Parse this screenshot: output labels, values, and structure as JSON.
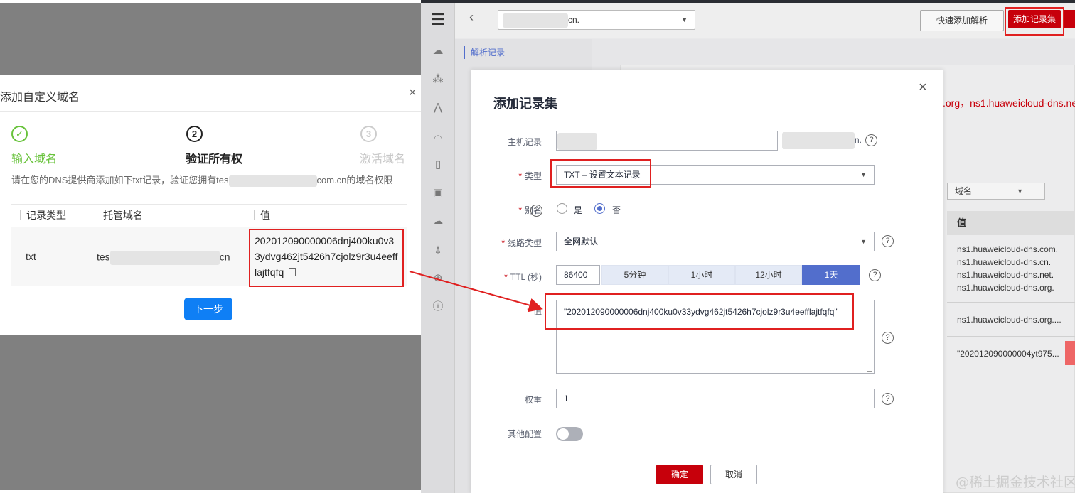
{
  "left_dialog": {
    "title": "添加自定义域名",
    "close_glyph": "×",
    "steps": [
      {
        "num": "✓",
        "label": "输入域名",
        "state": "done"
      },
      {
        "num": "2",
        "label": "验证所有权",
        "state": "active"
      },
      {
        "num": "3",
        "label": "激活域名",
        "state": "pending"
      }
    ],
    "desc_prefix": "请在您的DNS提供商添加如下txt记录，验证您拥有tes",
    "desc_suffix": "com.cn的域名权限",
    "columns": [
      "记录类型",
      "托管域名",
      "值"
    ],
    "row": {
      "type": "txt",
      "domain_prefix": "tes",
      "domain_suffix": "cn",
      "value": "202012090000006dnj400ku0v33ydvg462jt5426h7cjolz9r3u4eefflajtfqfq",
      "copy_icon": "copy-icon"
    },
    "next_label": "下一步"
  },
  "header": {
    "back_glyph": "‹",
    "domain_suffix": "cn.",
    "quick_add_label": "快速添加解析",
    "add_record_set_label": "添加记录集"
  },
  "subnav": {
    "item": "解析记录"
  },
  "background": {
    "ns_text": ".org，ns1.huaweicloud-dns.ne",
    "filter_label": "域名",
    "value_header": "值",
    "ns_lines": [
      "ns1.huaweicloud-dns.com.",
      "ns1.huaweicloud-dns.cn.",
      "ns1.huaweicloud-dns.net.",
      "ns1.huaweicloud-dns.org."
    ],
    "soa_line": "ns1.huaweicloud-dns.org....",
    "txt_line": "\"202012090000004yt975...",
    "watermark": "@稀土掘金技术社区"
  },
  "modal": {
    "title": "添加记录集",
    "close_glyph": "×",
    "host": {
      "label": "主机记录",
      "suffix": "n."
    },
    "type": {
      "label": "类型",
      "value": "TXT – 设置文本记录"
    },
    "alias": {
      "label": "别名",
      "yes": "是",
      "no": "否",
      "selected": "no"
    },
    "line": {
      "label": "线路类型",
      "value": "全网默认"
    },
    "ttl": {
      "label": "TTL (秒)",
      "value": "86400",
      "options": [
        "5分钟",
        "1小时",
        "12小时",
        "1天"
      ],
      "active": "1天"
    },
    "value": {
      "label": "值",
      "text": "\"202012090000006dnj400ku0v33ydvg462jt5426h7cjolz9r3u4eefflajtfqfq\""
    },
    "weight": {
      "label": "权重",
      "value": "1"
    },
    "other": {
      "label": "其他配置",
      "enabled": false
    },
    "ok_label": "确定",
    "cancel_label": "取消"
  },
  "colors": {
    "brand_red": "#c7000b",
    "annotation_red": "#e02020",
    "primary_blue": "#0f7ff5",
    "accent_blue": "#526ecc",
    "success_green": "#67c23a"
  }
}
